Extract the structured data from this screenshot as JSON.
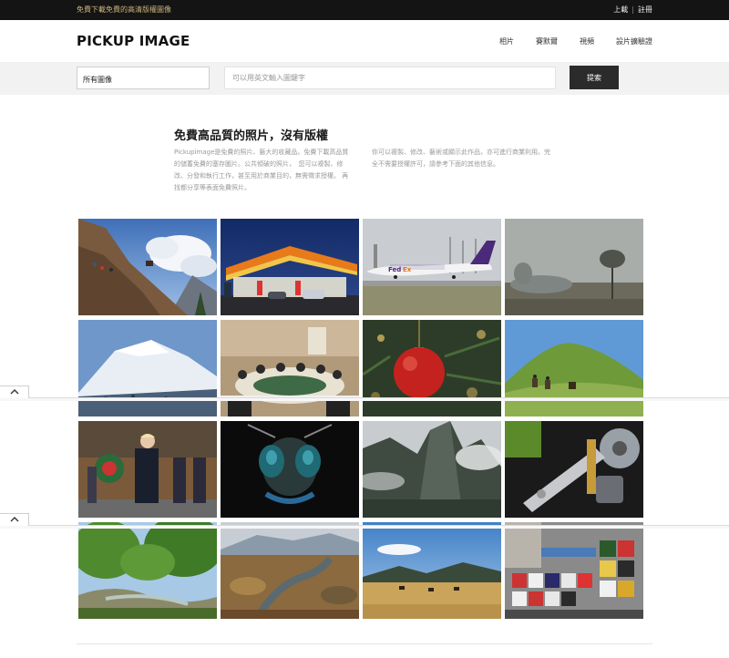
{
  "topbar": {
    "tagline": "免費下載免費的高清版權圖像",
    "upload": "上載",
    "register": "註冊",
    "separator": "|"
  },
  "header": {
    "logo": "PICKUP IMAGE",
    "nav": [
      "相片",
      "賽默爾",
      "視頻",
      "設片擴驗證"
    ]
  },
  "search": {
    "category": "所有圖像",
    "placeholder": "可以用英文輸入圖鍵字",
    "button": "提索"
  },
  "intro": {
    "title": "免費高品質的照片，沒有版權",
    "left": "Pickupimage是免費的照片、藝大的收藏品。免費下載高品質的儲蓄免費的塞存圖片。公共傾破的照片，　您可以複製、修改、分發和執行工作，甚至用於商業目的，無需徵求授權。 再找都分享等表面免費照片。",
    "right": "你可以複製、修改、藝術或顯示此作品，亦可進行商業利用。完全不需要授權許可，請參考下面的其他信息。"
  },
  "images": [
    {
      "name": "mountain-hikers-photo"
    },
    {
      "name": "gas-station-night-photo"
    },
    {
      "name": "fedex-airplane-photo"
    },
    {
      "name": "foggy-field-tree-photo"
    },
    {
      "name": "snow-mountain-photo"
    },
    {
      "name": "conference-meeting-photo"
    },
    {
      "name": "red-christmas-ornament-photo"
    },
    {
      "name": "green-hill-horses-photo"
    },
    {
      "name": "wreath-ceremony-photo"
    },
    {
      "name": "bee-macro-photo"
    },
    {
      "name": "misty-cliffs-photo"
    },
    {
      "name": "hard-drive-photo"
    },
    {
      "name": "green-forest-river-photo"
    },
    {
      "name": "autumn-mountain-stream-photo"
    },
    {
      "name": "grassland-cattle-photo"
    },
    {
      "name": "tshirt-shop-photo"
    }
  ],
  "icons": {
    "collapse": "chevron-up-icon"
  },
  "colors": {
    "topbar_bg": "#141414",
    "tagline": "#c9b27a",
    "search_button": "#2b2b2b",
    "search_band": "#f2f2f2"
  }
}
